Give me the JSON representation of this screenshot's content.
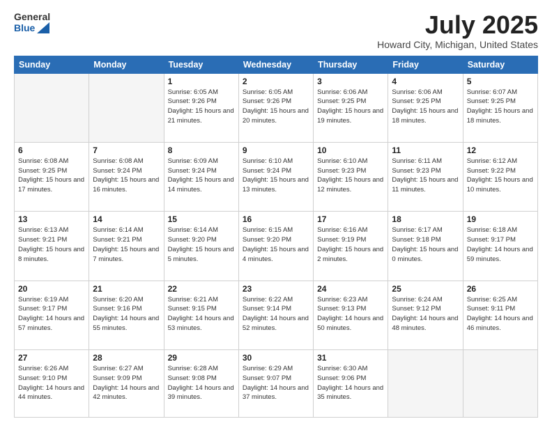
{
  "logo": {
    "general": "General",
    "blue": "Blue"
  },
  "title": "July 2025",
  "subtitle": "Howard City, Michigan, United States",
  "weekdays": [
    "Sunday",
    "Monday",
    "Tuesday",
    "Wednesday",
    "Thursday",
    "Friday",
    "Saturday"
  ],
  "weeks": [
    [
      {
        "day": "",
        "info": ""
      },
      {
        "day": "",
        "info": ""
      },
      {
        "day": "1",
        "info": "Sunrise: 6:05 AM\nSunset: 9:26 PM\nDaylight: 15 hours and 21 minutes."
      },
      {
        "day": "2",
        "info": "Sunrise: 6:05 AM\nSunset: 9:26 PM\nDaylight: 15 hours and 20 minutes."
      },
      {
        "day": "3",
        "info": "Sunrise: 6:06 AM\nSunset: 9:25 PM\nDaylight: 15 hours and 19 minutes."
      },
      {
        "day": "4",
        "info": "Sunrise: 6:06 AM\nSunset: 9:25 PM\nDaylight: 15 hours and 18 minutes."
      },
      {
        "day": "5",
        "info": "Sunrise: 6:07 AM\nSunset: 9:25 PM\nDaylight: 15 hours and 18 minutes."
      }
    ],
    [
      {
        "day": "6",
        "info": "Sunrise: 6:08 AM\nSunset: 9:25 PM\nDaylight: 15 hours and 17 minutes."
      },
      {
        "day": "7",
        "info": "Sunrise: 6:08 AM\nSunset: 9:24 PM\nDaylight: 15 hours and 16 minutes."
      },
      {
        "day": "8",
        "info": "Sunrise: 6:09 AM\nSunset: 9:24 PM\nDaylight: 15 hours and 14 minutes."
      },
      {
        "day": "9",
        "info": "Sunrise: 6:10 AM\nSunset: 9:24 PM\nDaylight: 15 hours and 13 minutes."
      },
      {
        "day": "10",
        "info": "Sunrise: 6:10 AM\nSunset: 9:23 PM\nDaylight: 15 hours and 12 minutes."
      },
      {
        "day": "11",
        "info": "Sunrise: 6:11 AM\nSunset: 9:23 PM\nDaylight: 15 hours and 11 minutes."
      },
      {
        "day": "12",
        "info": "Sunrise: 6:12 AM\nSunset: 9:22 PM\nDaylight: 15 hours and 10 minutes."
      }
    ],
    [
      {
        "day": "13",
        "info": "Sunrise: 6:13 AM\nSunset: 9:21 PM\nDaylight: 15 hours and 8 minutes."
      },
      {
        "day": "14",
        "info": "Sunrise: 6:14 AM\nSunset: 9:21 PM\nDaylight: 15 hours and 7 minutes."
      },
      {
        "day": "15",
        "info": "Sunrise: 6:14 AM\nSunset: 9:20 PM\nDaylight: 15 hours and 5 minutes."
      },
      {
        "day": "16",
        "info": "Sunrise: 6:15 AM\nSunset: 9:20 PM\nDaylight: 15 hours and 4 minutes."
      },
      {
        "day": "17",
        "info": "Sunrise: 6:16 AM\nSunset: 9:19 PM\nDaylight: 15 hours and 2 minutes."
      },
      {
        "day": "18",
        "info": "Sunrise: 6:17 AM\nSunset: 9:18 PM\nDaylight: 15 hours and 0 minutes."
      },
      {
        "day": "19",
        "info": "Sunrise: 6:18 AM\nSunset: 9:17 PM\nDaylight: 14 hours and 59 minutes."
      }
    ],
    [
      {
        "day": "20",
        "info": "Sunrise: 6:19 AM\nSunset: 9:17 PM\nDaylight: 14 hours and 57 minutes."
      },
      {
        "day": "21",
        "info": "Sunrise: 6:20 AM\nSunset: 9:16 PM\nDaylight: 14 hours and 55 minutes."
      },
      {
        "day": "22",
        "info": "Sunrise: 6:21 AM\nSunset: 9:15 PM\nDaylight: 14 hours and 53 minutes."
      },
      {
        "day": "23",
        "info": "Sunrise: 6:22 AM\nSunset: 9:14 PM\nDaylight: 14 hours and 52 minutes."
      },
      {
        "day": "24",
        "info": "Sunrise: 6:23 AM\nSunset: 9:13 PM\nDaylight: 14 hours and 50 minutes."
      },
      {
        "day": "25",
        "info": "Sunrise: 6:24 AM\nSunset: 9:12 PM\nDaylight: 14 hours and 48 minutes."
      },
      {
        "day": "26",
        "info": "Sunrise: 6:25 AM\nSunset: 9:11 PM\nDaylight: 14 hours and 46 minutes."
      }
    ],
    [
      {
        "day": "27",
        "info": "Sunrise: 6:26 AM\nSunset: 9:10 PM\nDaylight: 14 hours and 44 minutes."
      },
      {
        "day": "28",
        "info": "Sunrise: 6:27 AM\nSunset: 9:09 PM\nDaylight: 14 hours and 42 minutes."
      },
      {
        "day": "29",
        "info": "Sunrise: 6:28 AM\nSunset: 9:08 PM\nDaylight: 14 hours and 39 minutes."
      },
      {
        "day": "30",
        "info": "Sunrise: 6:29 AM\nSunset: 9:07 PM\nDaylight: 14 hours and 37 minutes."
      },
      {
        "day": "31",
        "info": "Sunrise: 6:30 AM\nSunset: 9:06 PM\nDaylight: 14 hours and 35 minutes."
      },
      {
        "day": "",
        "info": ""
      },
      {
        "day": "",
        "info": ""
      }
    ]
  ]
}
